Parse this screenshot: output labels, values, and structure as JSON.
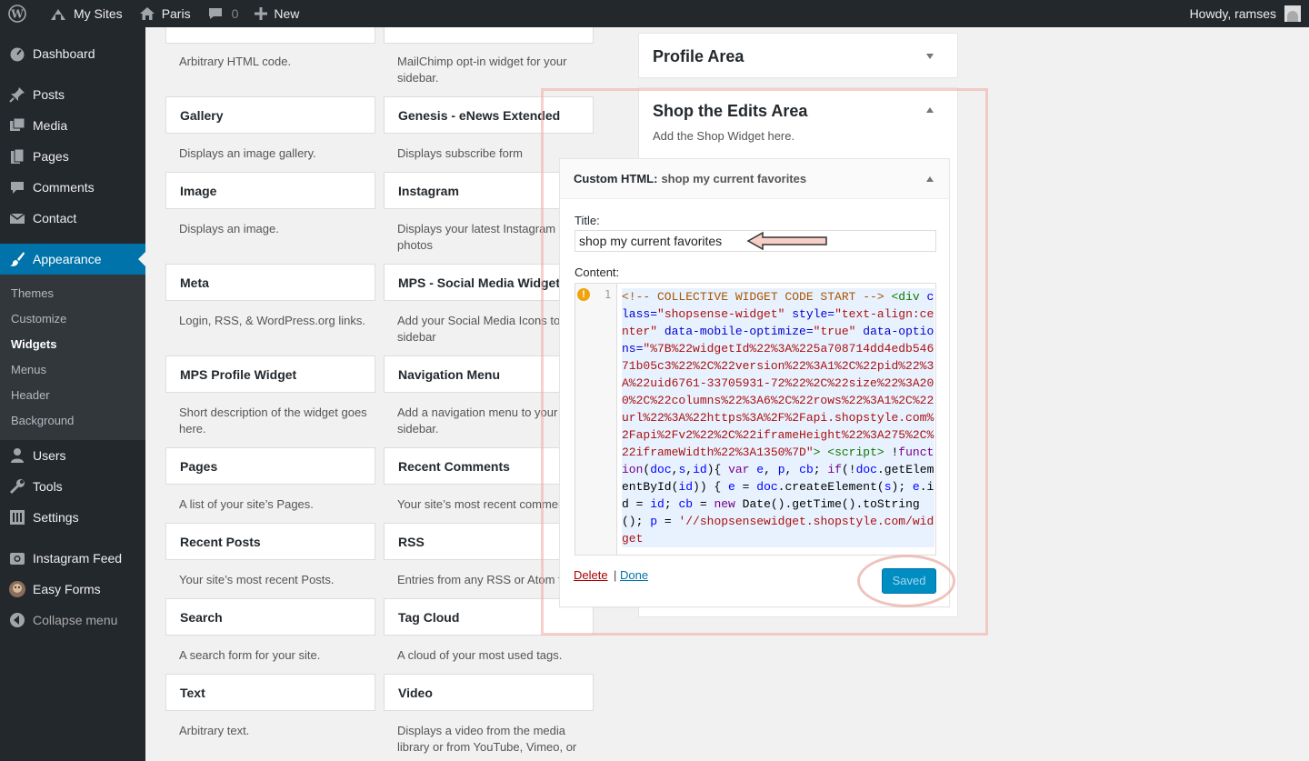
{
  "adminbar": {
    "my_sites": "My Sites",
    "site_name": "Paris",
    "comments_count": "0",
    "new_label": "New",
    "howdy": "Howdy, ramses"
  },
  "sidebar": {
    "items": [
      {
        "label": "Dashboard",
        "icon": "dashboard-icon"
      },
      {
        "label": "Posts",
        "icon": "pin-icon"
      },
      {
        "label": "Media",
        "icon": "media-icon"
      },
      {
        "label": "Pages",
        "icon": "pages-icon"
      },
      {
        "label": "Comments",
        "icon": "comment-icon"
      },
      {
        "label": "Contact",
        "icon": "envelope-icon"
      },
      {
        "label": "Appearance",
        "icon": "paintbrush-icon"
      },
      {
        "label": "Users",
        "icon": "users-icon"
      },
      {
        "label": "Tools",
        "icon": "wrench-icon"
      },
      {
        "label": "Settings",
        "icon": "settings-icon"
      },
      {
        "label": "Instagram Feed",
        "icon": "instagram-icon"
      },
      {
        "label": "Easy Forms",
        "icon": "easyforms-icon"
      },
      {
        "label": "Collapse menu",
        "icon": "collapse-icon"
      }
    ],
    "submenu": [
      "Themes",
      "Customize",
      "Widgets",
      "Menus",
      "Header",
      "Background"
    ]
  },
  "widgets": {
    "top_descs": [
      "Arbitrary HTML code.",
      "MailChimp opt-in widget for your sidebar."
    ],
    "tiles": [
      {
        "title": "Gallery",
        "desc": "Displays an image gallery."
      },
      {
        "title": "Genesis - eNews Extended",
        "desc": "Displays subscribe form"
      },
      {
        "title": "Image",
        "desc": "Displays an image."
      },
      {
        "title": "Instagram",
        "desc": "Displays your latest Instagram photos"
      },
      {
        "title": "Meta",
        "desc": "Login, RSS, & WordPress.org links."
      },
      {
        "title": "MPS - Social Media Widget",
        "desc": "Add your Social Media Icons to sidebar"
      },
      {
        "title": "MPS Profile Widget",
        "desc": "Short description of the widget goes here."
      },
      {
        "title": "Navigation Menu",
        "desc": "Add a navigation menu to your sidebar."
      },
      {
        "title": "Pages",
        "desc": "A list of your site’s Pages."
      },
      {
        "title": "Recent Comments",
        "desc": "Your site’s most recent commen"
      },
      {
        "title": "Recent Posts",
        "desc": "Your site’s most recent Posts."
      },
      {
        "title": "RSS",
        "desc": "Entries from any RSS or Atom fe"
      },
      {
        "title": "Search",
        "desc": "A search form for your site."
      },
      {
        "title": "Tag Cloud",
        "desc": "A cloud of your most used tags."
      },
      {
        "title": "Text",
        "desc": "Arbitrary text."
      },
      {
        "title": "Video",
        "desc": "Displays a video from the media library or from YouTube, Vimeo, or"
      }
    ]
  },
  "areas": {
    "profile": {
      "title": "Profile Area"
    },
    "shop": {
      "title": "Shop the Edits Area",
      "desc": "Add the Shop Widget here."
    }
  },
  "custom_html": {
    "header_prefix": "Custom HTML:",
    "header_title": "shop my current favorites",
    "title_label": "Title:",
    "title_value": "shop my current favorites",
    "content_label": "Content:",
    "line_number": "1",
    "code": [
      {
        "t": "<!-- COLLECTIVE WIDGET CODE START -->",
        "c": "c-com"
      },
      {
        "t": " ",
        "c": ""
      },
      {
        "t": "<div",
        "c": "c-tag"
      },
      {
        "t": " class=",
        "c": "c-attr"
      },
      {
        "t": "\"shopsense-widget\"",
        "c": "c-str"
      },
      {
        "t": " style=",
        "c": "c-attr"
      },
      {
        "t": "\"text-align:center\"",
        "c": "c-str"
      },
      {
        "t": " data-mobile-optimize=",
        "c": "c-attr"
      },
      {
        "t": "\"true\"",
        "c": "c-str"
      },
      {
        "t": " data-options=",
        "c": "c-attr"
      },
      {
        "t": "\"%7B%22widgetId%22%3A%225a708714dd4edb54671b05c3%22%2C%22version%22%3A1%2C%22pid%22%3A%22uid6761-33705931-72%22%2C%22size%22%3A200%2C%22columns%22%3A6%2C%22rows%22%3A1%2C%22url%22%3A%22https%3A%2F%2Fapi.shopstyle.com%2Fapi%2Fv2%22%2C%22iframeHeight%22%3A275%2C%22iframeWidth%22%3A1350%7D\"",
        "c": "c-str"
      },
      {
        "t": ">",
        "c": "c-tag"
      },
      {
        "t": " ",
        "c": ""
      },
      {
        "t": "<script>",
        "c": "c-tag"
      },
      {
        "t": " !",
        "c": ""
      },
      {
        "t": "function",
        "c": "c-kw"
      },
      {
        "t": "(",
        "c": ""
      },
      {
        "t": "doc",
        "c": "c-var"
      },
      {
        "t": ",",
        "c": ""
      },
      {
        "t": "s",
        "c": "c-var"
      },
      {
        "t": ",",
        "c": ""
      },
      {
        "t": "id",
        "c": "c-var"
      },
      {
        "t": "){ ",
        "c": ""
      },
      {
        "t": "var",
        "c": "c-kw"
      },
      {
        "t": " ",
        "c": ""
      },
      {
        "t": "e",
        "c": "c-var"
      },
      {
        "t": ", ",
        "c": ""
      },
      {
        "t": "p",
        "c": "c-var"
      },
      {
        "t": ", ",
        "c": ""
      },
      {
        "t": "cb",
        "c": "c-var"
      },
      {
        "t": "; ",
        "c": ""
      },
      {
        "t": "if",
        "c": "c-kw"
      },
      {
        "t": "(!",
        "c": ""
      },
      {
        "t": "doc",
        "c": "c-var"
      },
      {
        "t": ".getElementById(",
        "c": ""
      },
      {
        "t": "id",
        "c": "c-var"
      },
      {
        "t": ")) { ",
        "c": ""
      },
      {
        "t": "e",
        "c": "c-var"
      },
      {
        "t": " = ",
        "c": ""
      },
      {
        "t": "doc",
        "c": "c-var"
      },
      {
        "t": ".createElement(",
        "c": ""
      },
      {
        "t": "s",
        "c": "c-var"
      },
      {
        "t": "); ",
        "c": ""
      },
      {
        "t": "e",
        "c": "c-var"
      },
      {
        "t": ".id = ",
        "c": ""
      },
      {
        "t": "id",
        "c": "c-var"
      },
      {
        "t": "; ",
        "c": ""
      },
      {
        "t": "cb",
        "c": "c-var"
      },
      {
        "t": " = ",
        "c": ""
      },
      {
        "t": "new",
        "c": "c-kw"
      },
      {
        "t": " Date().getTime().toString(); ",
        "c": ""
      },
      {
        "t": "p",
        "c": "c-var"
      },
      {
        "t": " = ",
        "c": ""
      },
      {
        "t": "'//shopsensewidget.shopstyle.com/widget",
        "c": "c-str"
      }
    ],
    "delete_label": "Delete",
    "separator": "|",
    "done_label": "Done",
    "saved_label": "Saved"
  },
  "colors": {
    "adminbar_bg": "#23282d",
    "active_menu": "#0073aa",
    "saved_button": "#008ec2",
    "annotation": "#f0b4a8"
  }
}
